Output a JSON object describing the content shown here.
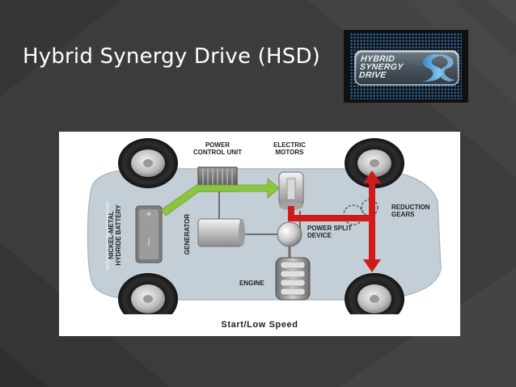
{
  "slide": {
    "title": "Hybrid Synergy Drive (HSD)"
  },
  "logo": {
    "lines": [
      "HYBRID",
      "SYNERGY",
      "DRIVE"
    ]
  },
  "diagram": {
    "labels": {
      "power_control_unit": "POWER\nCONTROL UNIT",
      "electric_motors": "ELECTRIC\nMOTORS",
      "reduction_gears": "REDUCTION\nGEARS",
      "power_split_device": "POWER SPLIT\nDEVICE",
      "generator": "GENERATOR",
      "battery": "NICKEL-METAL\nHYDRIDE BATTERY",
      "engine": "ENGINE",
      "battery_plus": "+",
      "battery_minus": "|"
    },
    "caption": "Start/Low Speed",
    "flow_colors": {
      "electric_flow": "#8cc63f",
      "drive_flow": "#d11a1a"
    }
  },
  "colors": {
    "slide_background": "#3d3d3d",
    "diagram_background": "#ffffff",
    "car_body": "#c4ced6",
    "title_text": "#ffffff"
  }
}
